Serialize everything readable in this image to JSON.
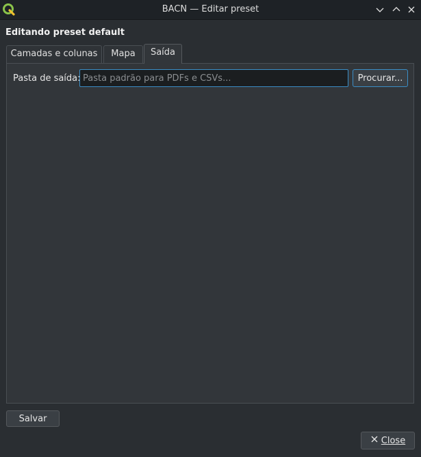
{
  "window": {
    "title": "BACN — Editar preset",
    "controls": [
      "chevron-down-icon",
      "chevron-up-icon",
      "close-icon"
    ]
  },
  "heading": "Editando preset default",
  "tabs": [
    {
      "label": "Camadas e colunas",
      "active": false
    },
    {
      "label": "Mapa",
      "active": false
    },
    {
      "label": "Saída",
      "active": true
    }
  ],
  "output": {
    "label": "Pasta de saída:",
    "value": "",
    "placeholder": "Pasta padrão para PDFs e CSVs...",
    "browse_label": "Procurar..."
  },
  "actions": {
    "save_label": "Salvar",
    "close_label": "Close"
  },
  "colors": {
    "background": "#2a2e32",
    "accent": "#3b8ec7",
    "logo": "#8bc34a"
  }
}
